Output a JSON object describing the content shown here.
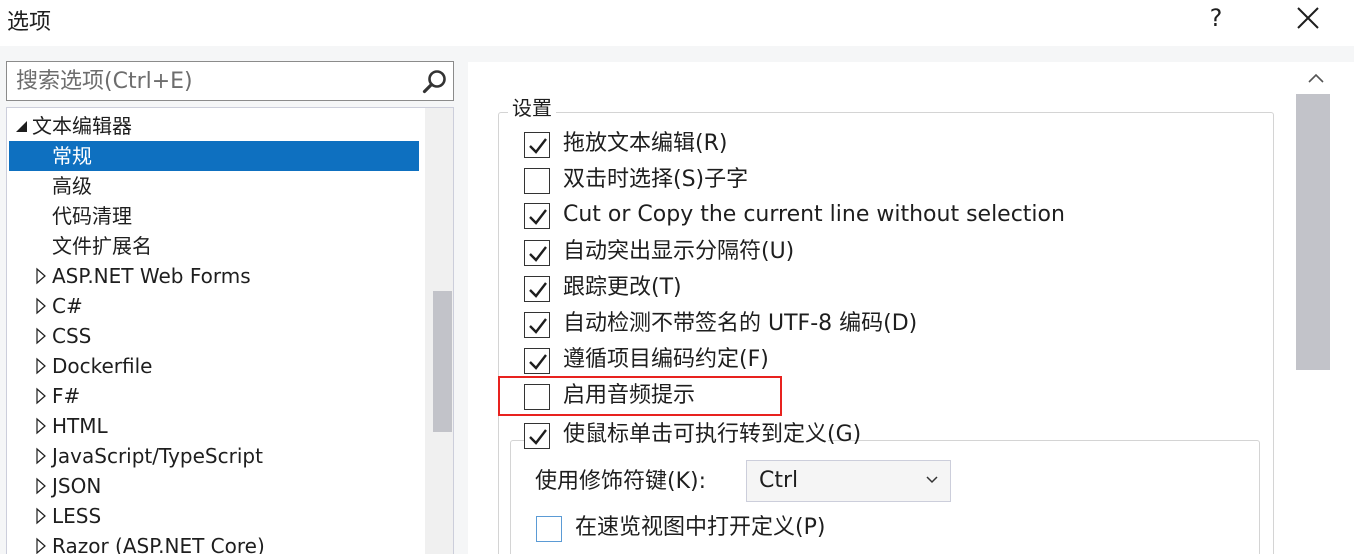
{
  "dialog": {
    "title": "选项",
    "help": "?"
  },
  "search": {
    "placeholder": "搜索选项(Ctrl+E)",
    "value": ""
  },
  "tree": {
    "items": [
      {
        "label": "文本编辑器",
        "expanded": true,
        "level": 0
      },
      {
        "label": "常规",
        "selected": true,
        "level": 1
      },
      {
        "label": "高级",
        "level": 1
      },
      {
        "label": "代码清理",
        "level": 1
      },
      {
        "label": "文件扩展名",
        "level": 1
      },
      {
        "label": "ASP.NET Web Forms",
        "level": 0
      },
      {
        "label": "C#",
        "level": 0
      },
      {
        "label": "CSS",
        "level": 0
      },
      {
        "label": "Dockerfile",
        "level": 0
      },
      {
        "label": "F#",
        "level": 0
      },
      {
        "label": "HTML",
        "level": 0
      },
      {
        "label": "JavaScript/TypeScript",
        "level": 0
      },
      {
        "label": "JSON",
        "level": 0
      },
      {
        "label": "LESS",
        "level": 0
      },
      {
        "label": "Razor (ASP.NET Core)",
        "level": 0
      }
    ]
  },
  "settings": {
    "group_label": "设置",
    "options": [
      {
        "label": "拖放文本编辑(R)",
        "checked": true
      },
      {
        "label": "双击时选择(S)子字",
        "checked": false
      },
      {
        "label": "Cut or Copy the current line without selection",
        "checked": true
      },
      {
        "label": "自动突出显示分隔符(U)",
        "checked": true
      },
      {
        "label": "跟踪更改(T)",
        "checked": true
      },
      {
        "label": "自动检测不带签名的 UTF-8 编码(D)",
        "checked": true
      },
      {
        "label": "遵循项目编码约定(F)",
        "checked": true
      },
      {
        "label": "启用音频提示",
        "checked": false,
        "highlighted": true
      },
      {
        "label": "使鼠标单击可执行转到定义(G)",
        "checked": true
      }
    ],
    "modifier": {
      "label": "使用修饰符键(K):",
      "value": "Ctrl"
    },
    "peek": {
      "label": "在速览视图中打开定义(P)",
      "checked": false
    }
  },
  "colors": {
    "selection": "#0e70c0",
    "highlight_border": "#e8221f",
    "peek_checkbox_border": "#5b9bd5"
  }
}
